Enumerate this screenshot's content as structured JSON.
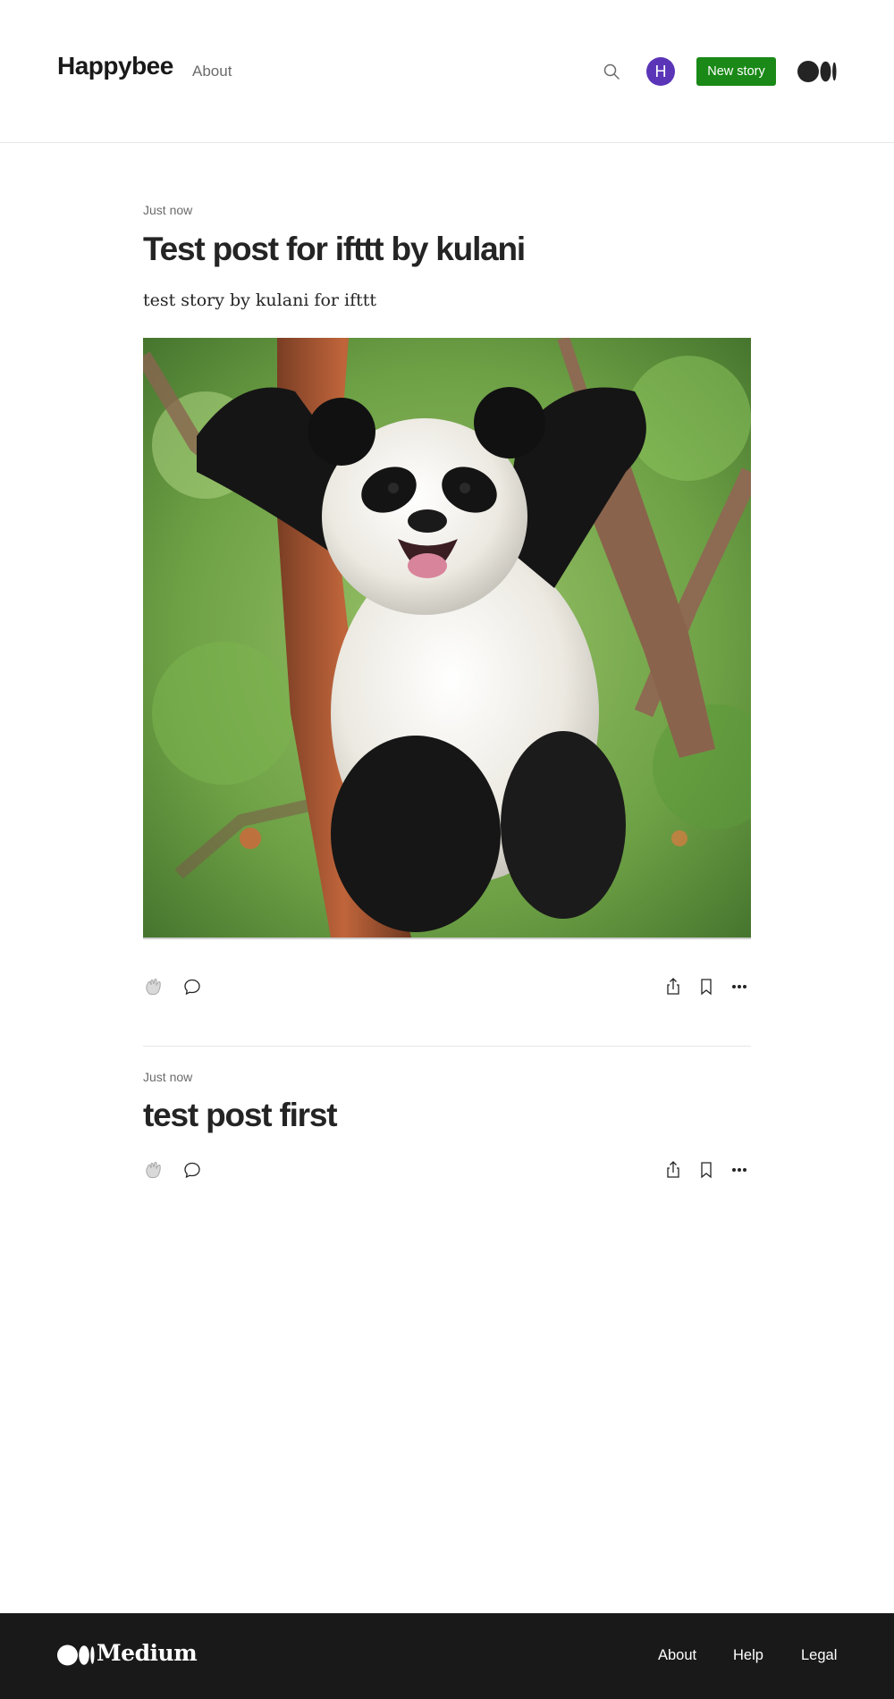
{
  "header": {
    "brand": "Happybee",
    "nav_about": "About",
    "avatar_initial": "H",
    "avatar_color": "#5a35b8",
    "new_story_label": "New story",
    "new_story_color": "#1a8917",
    "icons": [
      "search-icon",
      "medium-logo-icon"
    ]
  },
  "posts": [
    {
      "time": "Just now",
      "title": "Test post for ifttt by kulani",
      "subtitle": "test story by kulani for ifttt",
      "image": "panda-photo",
      "actions": [
        "clap-icon",
        "comment-icon",
        "share-icon",
        "bookmark-icon",
        "more-icon"
      ]
    },
    {
      "time": "Just now",
      "title": "test post first",
      "actions": [
        "clap-icon",
        "comment-icon",
        "share-icon",
        "bookmark-icon",
        "more-icon"
      ]
    }
  ],
  "footer": {
    "wordmark": "Medium",
    "links": [
      "About",
      "Help",
      "Legal"
    ],
    "background": "#191919"
  }
}
